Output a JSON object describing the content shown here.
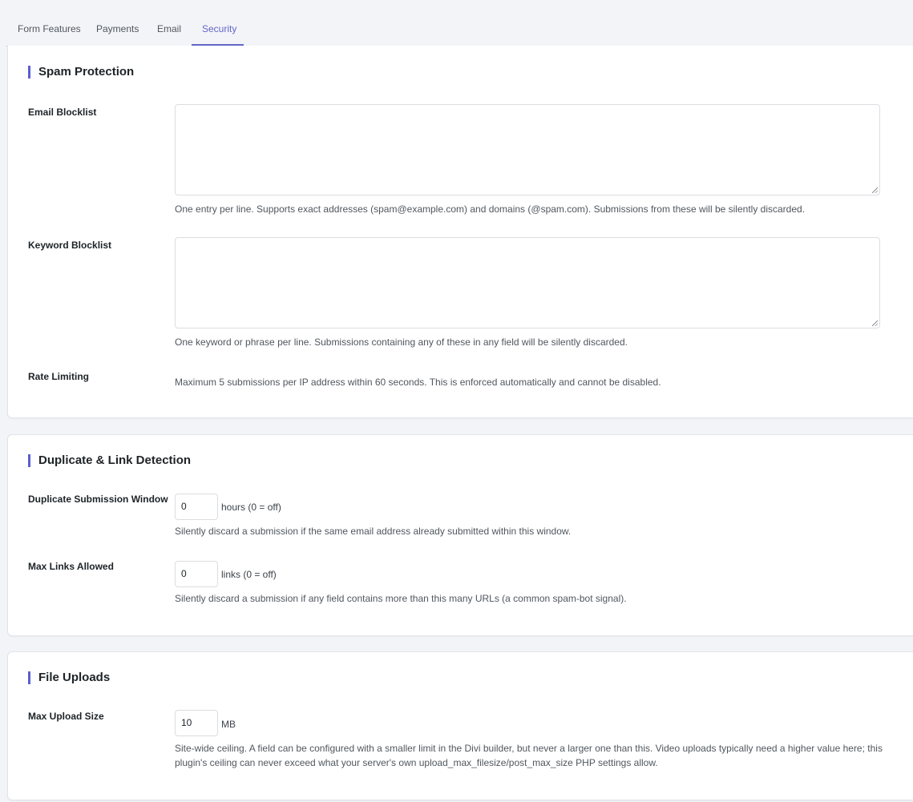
{
  "tabs": [
    {
      "label": "Form Features",
      "active": false
    },
    {
      "label": "Payments",
      "active": false
    },
    {
      "label": "Email",
      "active": false
    },
    {
      "label": "Security",
      "active": true
    }
  ],
  "accent_color": "#5b5fd0",
  "spam_protection": {
    "title": "Spam Protection",
    "email_blocklist": {
      "label": "Email Blocklist",
      "value": "",
      "help": "One entry per line. Supports exact addresses (spam@example.com) and domains (@spam.com). Submissions from these will be silently discarded."
    },
    "keyword_blocklist": {
      "label": "Keyword Blocklist",
      "value": "",
      "help": "One keyword or phrase per line. Submissions containing any of these in any field will be silently discarded."
    },
    "rate_limiting": {
      "label": "Rate Limiting",
      "help": "Maximum 5 submissions per IP address within 60 seconds. This is enforced automatically and cannot be disabled."
    }
  },
  "duplicate_link": {
    "title": "Duplicate & Link Detection",
    "duplicate_window": {
      "label": "Duplicate Submission Window",
      "value": "0",
      "unit": "hours (0 = off)",
      "help": "Silently discard a submission if the same email address already submitted within this window."
    },
    "max_links": {
      "label": "Max Links Allowed",
      "value": "0",
      "unit": "links (0 = off)",
      "help": "Silently discard a submission if any field contains more than this many URLs (a common spam-bot signal)."
    }
  },
  "file_uploads": {
    "title": "File Uploads",
    "max_upload": {
      "label": "Max Upload Size",
      "value": "10",
      "unit": "MB",
      "help_line1": "Site-wide ceiling. A field can be configured with a smaller limit in the Divi builder, but never a larger one than this. Video uploads typically need a higher value here; this",
      "help_line2": "plugin's ceiling can never exceed what your server's own upload_max_filesize/post_max_size PHP settings allow."
    }
  }
}
